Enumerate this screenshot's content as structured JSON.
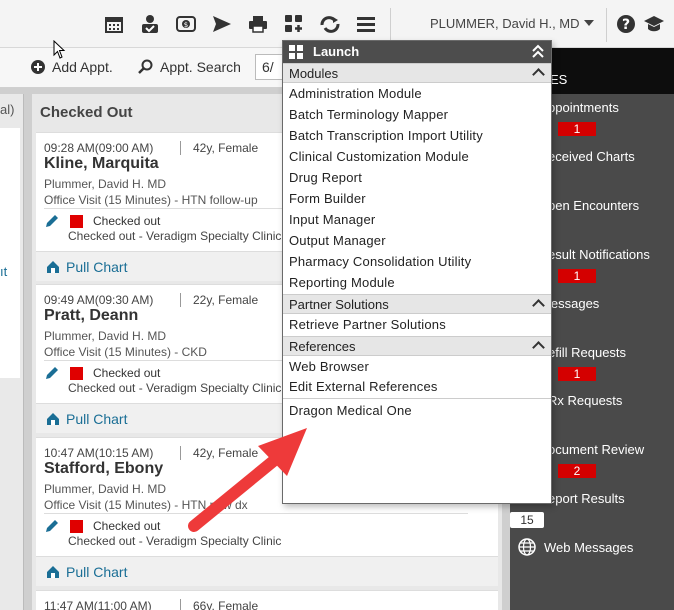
{
  "topbar": {
    "icons": [
      "calendar-icon",
      "task-user-icon",
      "money-icon",
      "send-icon",
      "printer-icon",
      "apps-add-icon",
      "refresh-sync-icon",
      "menu-icon",
      "help-icon",
      "education-icon"
    ],
    "user_name": "PLUMMER, David H., MD"
  },
  "toolbar2": {
    "add_appt": "Add Appt.",
    "appt_search": "Appt. Search",
    "date_value": "6/"
  },
  "left_column": {
    "header": "al)",
    "link": "ıt"
  },
  "checked_out": {
    "header": "Checked Out",
    "cards": [
      {
        "time": "09:28 AM(09:00 AM)",
        "age_sex": "42y, Female",
        "name": "Kline, Marquita",
        "provider": "Plummer, David H. MD",
        "visit": "Office Visit (15 Minutes) - HTN follow-up",
        "status": "Checked out",
        "status_detail": "Checked out - Veradigm Specialty Clinic",
        "pull_chart": "Pull Chart"
      },
      {
        "time": "09:49 AM(09:30 AM)",
        "age_sex": "22y, Female",
        "name": "Pratt, Deann",
        "provider": "Plummer, David H. MD",
        "visit": "Office Visit (15 Minutes) - CKD",
        "status": "Checked out",
        "status_detail": "Checked out - Veradigm Specialty Clinic",
        "pull_chart": "Pull Chart"
      },
      {
        "time": "10:47 AM(10:15 AM)",
        "age_sex": "42y, Female",
        "name": "Stafford, Ebony",
        "provider": "Plummer, David H. MD",
        "visit": "Office Visit (15 Minutes) - HTN new dx",
        "status": "Checked out",
        "status_detail": "Checked out - Veradigm Specialty Clinic",
        "pull_chart": "Pull Chart"
      },
      {
        "time": "11:47 AM(11:00 AM)",
        "age_sex": "66y, Female"
      }
    ]
  },
  "right_sidebar": {
    "header": "ES",
    "items": [
      {
        "label": "ppointments",
        "badge": "1"
      },
      {
        "label": "eceived Charts"
      },
      {
        "label": "pen Encounters"
      },
      {
        "label": "esult Notifications",
        "badge": "1"
      },
      {
        "label": "lessages"
      },
      {
        "label": "efill Requests",
        "badge": "1"
      },
      {
        "label": "Rx Requests"
      },
      {
        "label": "ocument Review",
        "badge": "2"
      },
      {
        "label": "eport Results"
      }
    ],
    "count_badge": "15",
    "web_messages": "Web Messages"
  },
  "launch": {
    "title": "Launch",
    "sections": [
      {
        "title": "Modules",
        "items": [
          "Administration Module",
          "Batch Terminology Mapper",
          "Batch Transcription Import Utility",
          "Clinical Customization Module",
          "Drug Report",
          "Form Builder",
          "Input Manager",
          "Output Manager",
          "Pharmacy Consolidation Utility",
          "Reporting Module"
        ]
      },
      {
        "title": "Partner Solutions",
        "items": [
          "Retrieve Partner Solutions"
        ]
      },
      {
        "title": "References",
        "items": [
          "Web Browser",
          "Edit External References"
        ]
      }
    ],
    "extra_item": "Dragon Medical One"
  },
  "colors": {
    "accent_link": "#1a6e95",
    "badge_red": "#d40000",
    "annotation_arrow": "#ee3a3a",
    "sidebar_bg": "#4a4a4a"
  }
}
